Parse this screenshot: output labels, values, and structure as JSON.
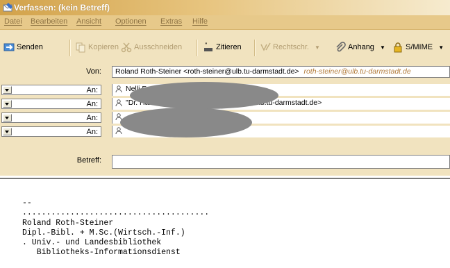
{
  "window": {
    "title": "Verfassen: (kein Betreff)"
  },
  "menu": [
    "Datei",
    "Bearbeiten",
    "Ansicht",
    "Optionen",
    "Extras",
    "Hilfe"
  ],
  "toolbar": {
    "send": "Senden",
    "copy": "Kopieren",
    "cut": "Ausschneiden",
    "quote": "Zitieren",
    "spell": "Rechtschr.",
    "attach": "Anhang",
    "smime": "S/MIME"
  },
  "headers": {
    "from_label": "Von:",
    "from_value": "Roland Roth-Steiner <roth-steiner@ulb.tu-darmstadt.de>",
    "from_hint": "roth-steiner@ulb.tu-darmstadt.de",
    "recipients": [
      {
        "label": "An:",
        "value": "Nelli F"
      },
      {
        "label": "An:",
        "value": "\"Dr. Han                                    <Nolte@ulb.tu-darmstadt.de>"
      },
      {
        "label": "An:",
        "value": ""
      },
      {
        "label": "An:",
        "value": ""
      }
    ],
    "subject_label": "Betreff:",
    "subject_value": ""
  },
  "body": {
    "text": "--\n.......................................\nRoland Roth-Steiner\nDipl.-Bibl. + M.Sc.(Wirtsch.-Inf.)\n. Univ.- und Landesbibliothek\n   Bibliotheks-Informationsdienst"
  }
}
